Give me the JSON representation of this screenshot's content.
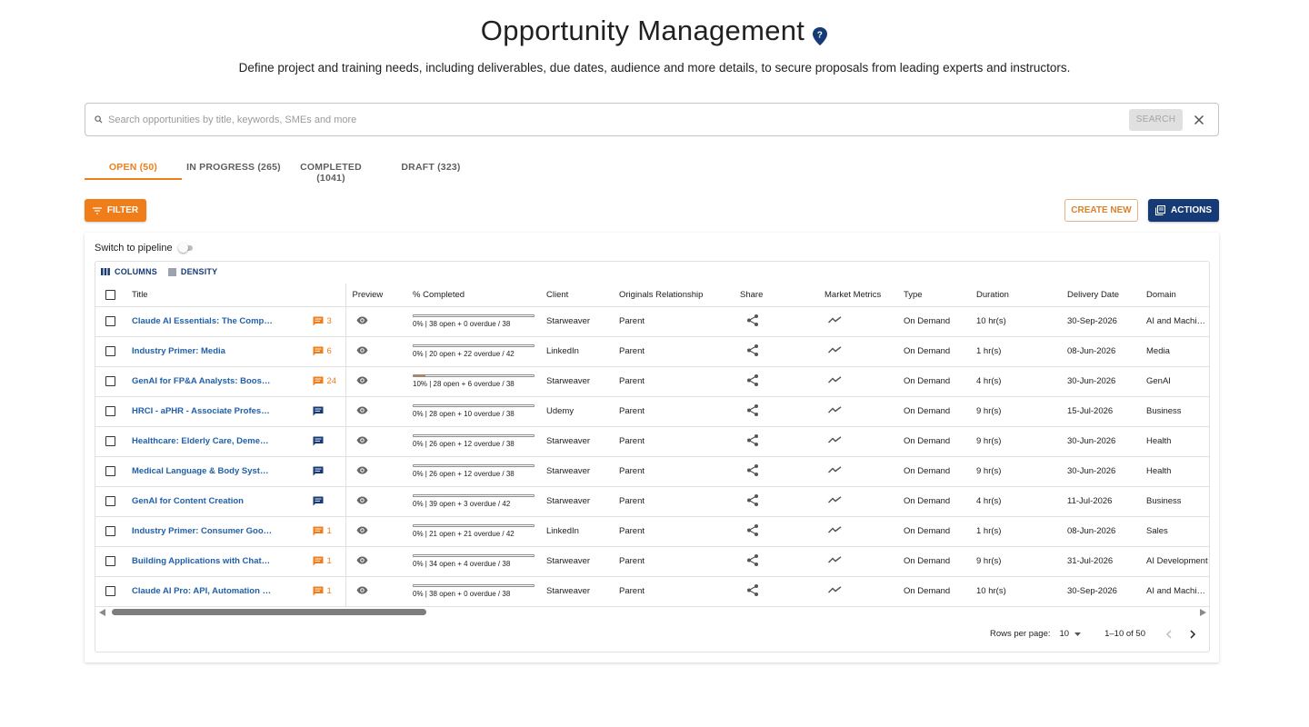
{
  "header": {
    "title": "Opportunity Management",
    "subtitle": "Define project and training needs, including deliverables, due dates, audience and more details, to secure proposals from leading experts and instructors."
  },
  "search": {
    "placeholder": "Search opportunities by title, keywords, SMEs and more",
    "button_label": "SEARCH"
  },
  "tabs": [
    {
      "label": "OPEN (50)",
      "active": true
    },
    {
      "label": "IN PROGRESS (265)",
      "active": false
    },
    {
      "label": "COMPLETED (1041)",
      "active": false
    },
    {
      "label": "DRAFT (323)",
      "active": false
    }
  ],
  "toolbar": {
    "filter_label": "FILTER",
    "create_label": "CREATE NEW",
    "actions_label": "ACTIONS"
  },
  "pipeline_label": "Switch to pipeline",
  "grid_toolbar": {
    "columns_label": "COLUMNS",
    "density_label": "DENSITY"
  },
  "columns": [
    "Title",
    "Preview",
    "% Completed",
    "Client",
    "Originals Relationship",
    "Share",
    "Market Metrics",
    "Type",
    "Duration",
    "Delivery Date",
    "Domain"
  ],
  "rows": [
    {
      "title": "Claude AI Essentials: The Complete Guide",
      "comments": "3",
      "comment_color": "#ef7d1a",
      "progress": 0,
      "progress_text": "0% | 38 open + 0 overdue / 38",
      "client": "Starweaver",
      "relationship": "Parent",
      "type": "On Demand",
      "duration": "10 hr(s)",
      "delivery": "30-Sep-2026",
      "domain": "AI and Machine Learning"
    },
    {
      "title": "Industry Primer: Media",
      "comments": "6",
      "comment_color": "#ef7d1a",
      "progress": 0,
      "progress_text": "0% | 20 open + 22 overdue / 42",
      "client": "LinkedIn",
      "relationship": "Parent",
      "type": "On Demand",
      "duration": "1 hr(s)",
      "delivery": "08-Jun-2026",
      "domain": "Media"
    },
    {
      "title": "GenAI for FP&A Analysts: Boosting Forecasting",
      "comments": "24",
      "comment_color": "#ef7d1a",
      "progress": 10,
      "progress_text": "10% | 28 open + 6 overdue / 38",
      "client": "Starweaver",
      "relationship": "Parent",
      "type": "On Demand",
      "duration": "4 hr(s)",
      "delivery": "30-Jun-2026",
      "domain": "GenAI"
    },
    {
      "title": "HRCI - aPHR - Associate Professional in HR",
      "comments": "",
      "comment_color": "#163a75",
      "progress": 0,
      "progress_text": "0% | 28 open + 10 overdue / 38",
      "client": "Udemy",
      "relationship": "Parent",
      "type": "On Demand",
      "duration": "9 hr(s)",
      "delivery": "15-Jul-2026",
      "domain": "Business"
    },
    {
      "title": "Healthcare: Elderly Care, Dementia and More",
      "comments": "",
      "comment_color": "#163a75",
      "progress": 0,
      "progress_text": "0% | 26 open + 12 overdue / 38",
      "client": "Starweaver",
      "relationship": "Parent",
      "type": "On Demand",
      "duration": "9 hr(s)",
      "delivery": "30-Jun-2026",
      "domain": "Health"
    },
    {
      "title": "Medical Language & Body Systems Fundamentals",
      "comments": "",
      "comment_color": "#163a75",
      "progress": 0,
      "progress_text": "0% | 26 open + 12 overdue / 38",
      "client": "Starweaver",
      "relationship": "Parent",
      "type": "On Demand",
      "duration": "9 hr(s)",
      "delivery": "30-Jun-2026",
      "domain": "Health"
    },
    {
      "title": "GenAI for Content Creation",
      "comments": "",
      "comment_color": "#163a75",
      "progress": 0,
      "progress_text": "0% | 39 open + 3 overdue / 42",
      "client": "Starweaver",
      "relationship": "Parent",
      "type": "On Demand",
      "duration": "4 hr(s)",
      "delivery": "11-Jul-2026",
      "domain": "Business"
    },
    {
      "title": "Industry Primer: Consumer Goods",
      "comments": "1",
      "comment_color": "#ef7d1a",
      "progress": 0,
      "progress_text": "0% | 21 open + 21 overdue / 42",
      "client": "LinkedIn",
      "relationship": "Parent",
      "type": "On Demand",
      "duration": "1 hr(s)",
      "delivery": "08-Jun-2026",
      "domain": "Sales"
    },
    {
      "title": "Building Applications with ChatGPT API",
      "comments": "1",
      "comment_color": "#ef7d1a",
      "progress": 0,
      "progress_text": "0% | 34 open + 4 overdue / 38",
      "client": "Starweaver",
      "relationship": "Parent",
      "type": "On Demand",
      "duration": "9 hr(s)",
      "delivery": "31-Jul-2026",
      "domain": "AI Development"
    },
    {
      "title": "Claude AI Pro: API, Automation & Agents",
      "comments": "1",
      "comment_color": "#ef7d1a",
      "progress": 0,
      "progress_text": "0% | 38 open + 0 overdue / 38",
      "client": "Starweaver",
      "relationship": "Parent",
      "type": "On Demand",
      "duration": "10 hr(s)",
      "delivery": "30-Sep-2026",
      "domain": "AI and Machine Learning"
    }
  ],
  "pagination": {
    "rows_per_page_label": "Rows per page:",
    "rows_per_page": "10",
    "range": "1–10 of 50"
  },
  "colors": {
    "accent": "#ef7d1a",
    "navy": "#163a75",
    "link": "#1f5fa9"
  }
}
